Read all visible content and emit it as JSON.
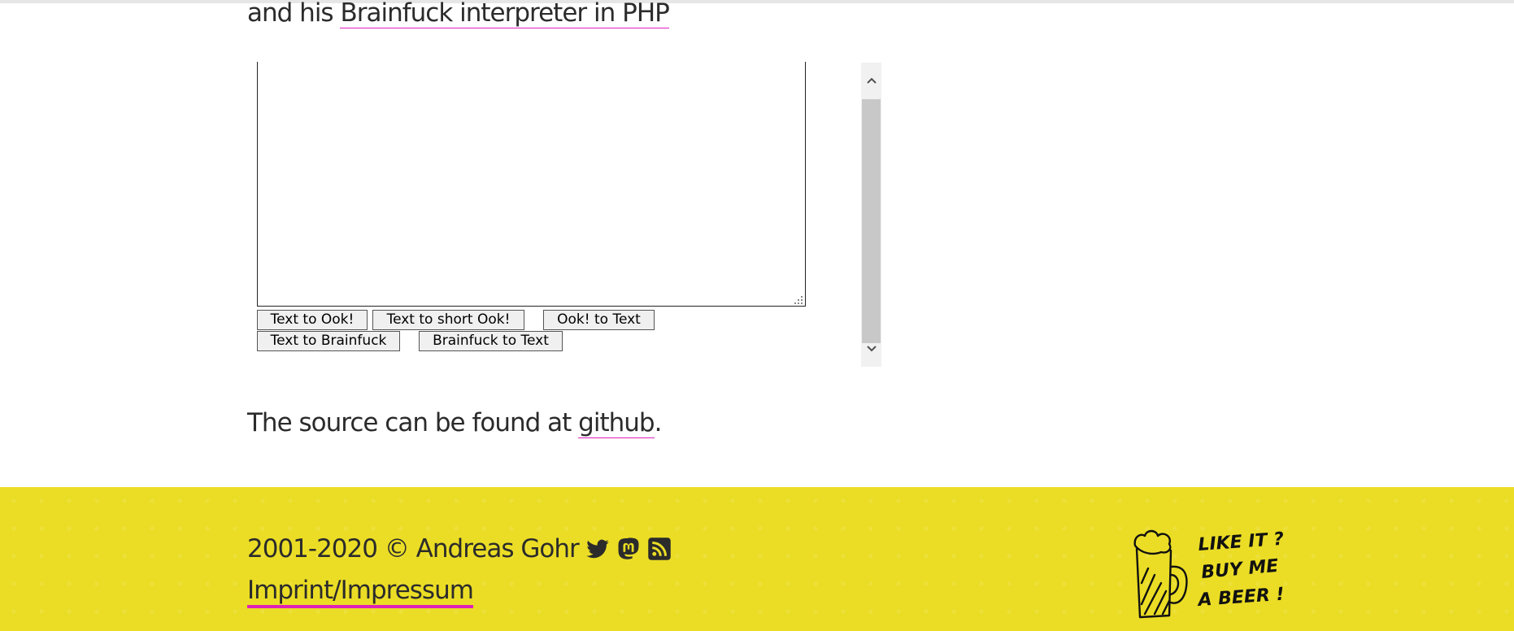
{
  "intro": {
    "prefix": "and his ",
    "link": "Brainfuck interpreter in PHP"
  },
  "buttons": {
    "text_to_ook": "Text to Ook!",
    "text_to_short_ook": "Text to short Ook!",
    "ook_to_text": "Ook! to Text",
    "text_to_brainfuck": "Text to Brainfuck",
    "brainfuck_to_text": "Brainfuck to Text"
  },
  "source": {
    "prefix": "The source can be found at ",
    "link": "github",
    "suffix": "."
  },
  "footer": {
    "copyright": "2001-2020 © Andreas Gohr",
    "imprint": "Imprint/Impressum",
    "icons": [
      "twitter-icon",
      "mastodon-icon",
      "rss-icon"
    ],
    "beer_lines": [
      "LIKE IT ?",
      "BUY ME",
      "A BEER !"
    ],
    "background_color": "#ebdd25",
    "link_underline_color": "#e020b8"
  }
}
